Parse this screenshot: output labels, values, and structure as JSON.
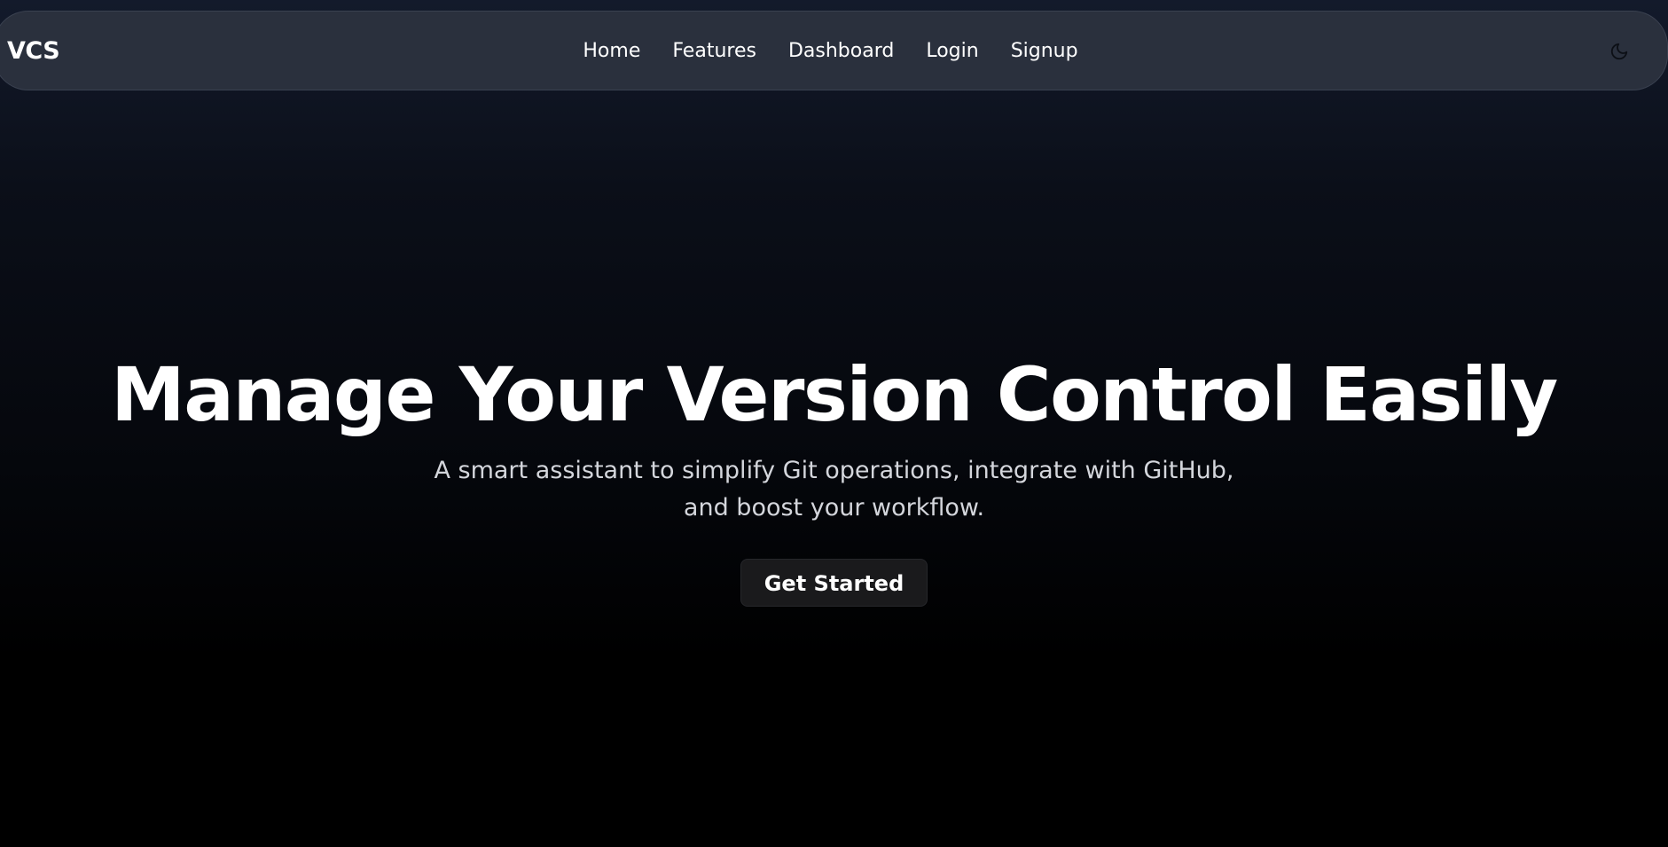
{
  "navbar": {
    "brand": "VCS",
    "links": [
      {
        "label": "Home"
      },
      {
        "label": "Features"
      },
      {
        "label": "Dashboard"
      },
      {
        "label": "Login"
      },
      {
        "label": "Signup"
      }
    ],
    "theme_icon": "moon-icon"
  },
  "hero": {
    "title": "Manage Your Version Control Easily",
    "subtitle": "A smart assistant to simplify Git operations, integrate with GitHub, and boost your workflow.",
    "cta_label": "Get Started"
  },
  "colors": {
    "navbar_bg": "#2a303d",
    "page_top": "#131a2b",
    "page_bottom": "#000000",
    "button_bg": "#1a1a1c",
    "text": "#ffffff",
    "subtitle_text": "#d4d6dc"
  }
}
